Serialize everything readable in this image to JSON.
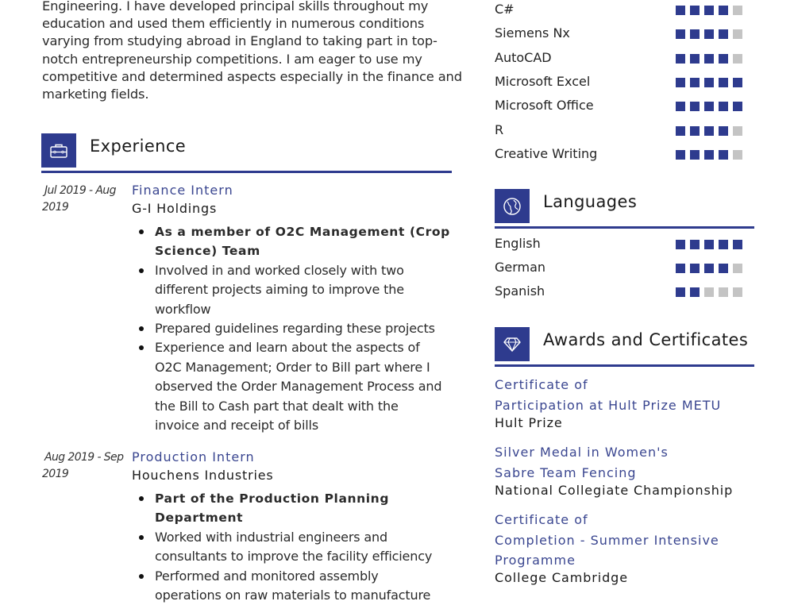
{
  "summary": {
    "lines": [
      "Engineering. I have developed principal skills throughout my",
      "education and used them efficiently in numerous conditions",
      "varying from studying abroad in England to taking part in top-",
      "notch entrepreneurship competitions. I am eager to use my",
      "competitive and determined aspects especially in the finance and",
      "marketing fields."
    ]
  },
  "experience": {
    "title": "Experience",
    "icon": "briefcase-icon",
    "jobs": [
      {
        "date_line1": "Jul 2019 - Aug",
        "date_line2": "2019",
        "title": "Finance Intern",
        "company": "G-I Holdings",
        "bullets": [
          {
            "lines": [
              "As a member of O2C Management (Crop",
              "Science) Team"
            ],
            "bold": true
          },
          {
            "lines": [
              "Involved in and worked closely with two",
              "different projects aiming to improve the",
              "workflow"
            ],
            "bold": false
          },
          {
            "lines": [
              "Prepared guidelines regarding these projects"
            ],
            "bold": false
          },
          {
            "lines": [
              "Experience and learn about the aspects of",
              "O2C Management; Order to Bill part where I",
              "observed the Order Management Process and",
              "the Bill to Cash part that dealt with the",
              "invoice and receipt of bills"
            ],
            "bold": false
          }
        ]
      },
      {
        "date_line1": "Aug 2019 - Sep",
        "date_line2": "2019",
        "title": "Production Intern",
        "company": "Houchens Industries",
        "bullets": [
          {
            "lines": [
              "Part of the Production Planning",
              "Department"
            ],
            "bold": true
          },
          {
            "lines": [
              "Worked with industrial engineers and",
              "consultants to improve the facility efficiency"
            ],
            "bold": false
          },
          {
            "lines": [
              "Performed and monitored assembly",
              "operations on raw materials to manufacture"
            ],
            "bold": false
          }
        ]
      }
    ]
  },
  "skills": {
    "items": [
      {
        "label": "C#",
        "level": 4,
        "max": 5
      },
      {
        "label": "Siemens Nx",
        "level": 4,
        "max": 5
      },
      {
        "label": "AutoCAD",
        "level": 4,
        "max": 5
      },
      {
        "label": "Microsoft Excel",
        "level": 5,
        "max": 5
      },
      {
        "label": "Microsoft Office",
        "level": 5,
        "max": 5
      },
      {
        "label": "R",
        "level": 4,
        "max": 5
      },
      {
        "label": "Creative Writing",
        "level": 4,
        "max": 5
      }
    ]
  },
  "languages": {
    "title": "Languages",
    "icon": "globe-icon",
    "items": [
      {
        "label": "English",
        "level": 5,
        "max": 5
      },
      {
        "label": "German",
        "level": 4,
        "max": 5
      },
      {
        "label": "Spanish",
        "level": 2,
        "max": 5
      }
    ]
  },
  "awards": {
    "title": "Awards and Certificates",
    "icon": "diamond-icon",
    "items": [
      {
        "title_lines": [
          "Certificate of",
          "Participation at Hult Prize METU"
        ],
        "org": "Hult Prize"
      },
      {
        "title_lines": [
          "Silver Medal in Women's",
          "Sabre Team Fencing"
        ],
        "org": "National Collegiate Championship"
      },
      {
        "title_lines": [
          "Certificate of",
          "Completion - Summer Intensive",
          "Programme"
        ],
        "org": "College Cambridge"
      }
    ]
  },
  "colors": {
    "accent": "#2e3b8e",
    "rating_off": "#c4c4c4",
    "title_text": "#3a4690"
  }
}
